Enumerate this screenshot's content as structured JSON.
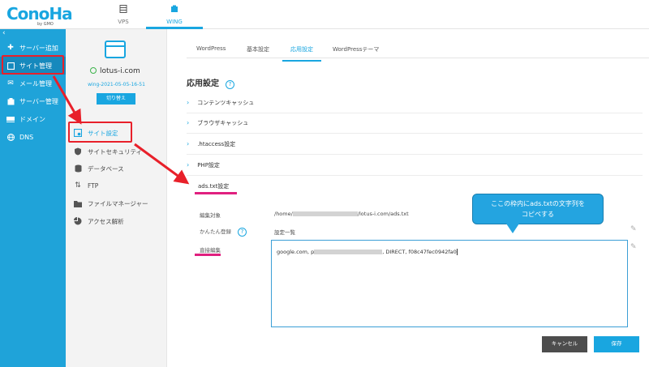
{
  "brand": {
    "logo_text": "ConoHa",
    "logo_sub": "by GMO"
  },
  "top_nav": {
    "vps": "VPS",
    "wing": "WING"
  },
  "sidebar": {
    "items": [
      {
        "label": "サーバー追加",
        "icon": "plus-icon"
      },
      {
        "label": "サイト管理",
        "icon": "site-icon"
      },
      {
        "label": "メール管理",
        "icon": "mail-icon"
      },
      {
        "label": "サーバー管理",
        "icon": "server-icon"
      },
      {
        "label": "ドメイン",
        "icon": "domain-icon"
      },
      {
        "label": "DNS",
        "icon": "globe-icon"
      }
    ]
  },
  "site_panel": {
    "site_name": "lotus-i.com",
    "wing_id": "wing-2021-05-05-16-51",
    "switch_label": "切り替え",
    "items": [
      {
        "label": "サイト設定",
        "icon": "site-settings-icon"
      },
      {
        "label": "サイトセキュリティ",
        "icon": "shield-icon"
      },
      {
        "label": "データベース",
        "icon": "database-icon"
      },
      {
        "label": "FTP",
        "icon": "ftp-icon"
      },
      {
        "label": "ファイルマネージャー",
        "icon": "folder-icon"
      },
      {
        "label": "アクセス解析",
        "icon": "pie-chart-icon"
      }
    ]
  },
  "tabs": [
    "WordPress",
    "基本設定",
    "応用設定",
    "WordPressテーマ"
  ],
  "main": {
    "heading": "応用設定",
    "help": "?",
    "accordion": [
      "コンテンツキャッシュ",
      "ブラウザキャッシュ",
      ".htaccess設定",
      "PHP設定",
      "ads.txt設定"
    ],
    "edit_target_label": "編集対象",
    "edit_target_prefix": "/home/",
    "edit_target_suffix": "/lotus-i.com/ads.txt",
    "easy_reg_label": "かんたん登録",
    "easy_reg_value": "設定一覧",
    "direct_edit_label": "直接編集",
    "editor_prefix": "google.com, p",
    "editor_suffix": ", DIRECT, f08c47fec0942fa0",
    "callout_line1": "ここの枠内にads.txtの文字列を",
    "callout_line2": "コピペする",
    "cancel_label": "キャンセル",
    "save_label": "保存"
  },
  "colors": {
    "accent": "#19a6e0",
    "sidebar": "#1fa3d9",
    "annotation_red": "#e8202a",
    "annotation_pink": "#e0207f"
  }
}
